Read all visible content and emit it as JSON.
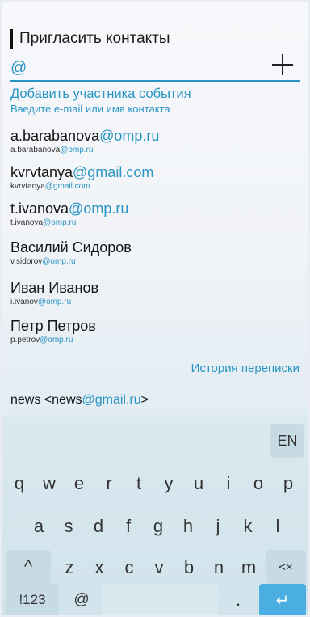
{
  "header": {
    "title": "Пригласить контакты"
  },
  "input": {
    "value": "@"
  },
  "hint": {
    "title": "Добавить участника события",
    "subtitle": "Введите e-mail или имя контакта"
  },
  "contacts": [
    {
      "name_pre": "a.barabanova",
      "name_hl": "@omp.ru",
      "email_pre": "a.barabanova",
      "email_hl": "@omp.ru"
    },
    {
      "name_pre": "kvrvtanya",
      "name_hl": "@gmail.com",
      "email_pre": "kvrvtanya",
      "email_hl": "@gmail.com"
    },
    {
      "name_pre": "t.ivanova",
      "name_hl": "@omp.ru",
      "email_pre": "t.ivanova",
      "email_hl": "@omp.ru"
    },
    {
      "name_pre": "Василий Сидоров",
      "name_hl": "",
      "email_pre": "v.sidorov",
      "email_hl": "@omp.ru"
    },
    {
      "name_pre": "Иван Иванов",
      "name_hl": "",
      "email_pre": "i.ivanov",
      "email_hl": "@omp.ru"
    },
    {
      "name_pre": "Петр Петров",
      "name_hl": "",
      "email_pre": "p.petrov",
      "email_hl": "@omp.ru"
    }
  ],
  "history_link": "История переписки",
  "news": {
    "pre": "news <news",
    "hl": "@gmail.ru",
    "post": ">"
  },
  "keyboard": {
    "lang": "EN",
    "row1": [
      "q",
      "w",
      "e",
      "r",
      "t",
      "y",
      "u",
      "i",
      "o",
      "p"
    ],
    "row2": [
      "a",
      "s",
      "d",
      "f",
      "g",
      "h",
      "j",
      "k",
      "l"
    ],
    "row3": [
      "z",
      "x",
      "c",
      "v",
      "b",
      "n",
      "m"
    ],
    "shift": "^",
    "backspace": "<×",
    "symbols": "!123",
    "at": "@",
    "dot": ".",
    "enter": "↵"
  }
}
